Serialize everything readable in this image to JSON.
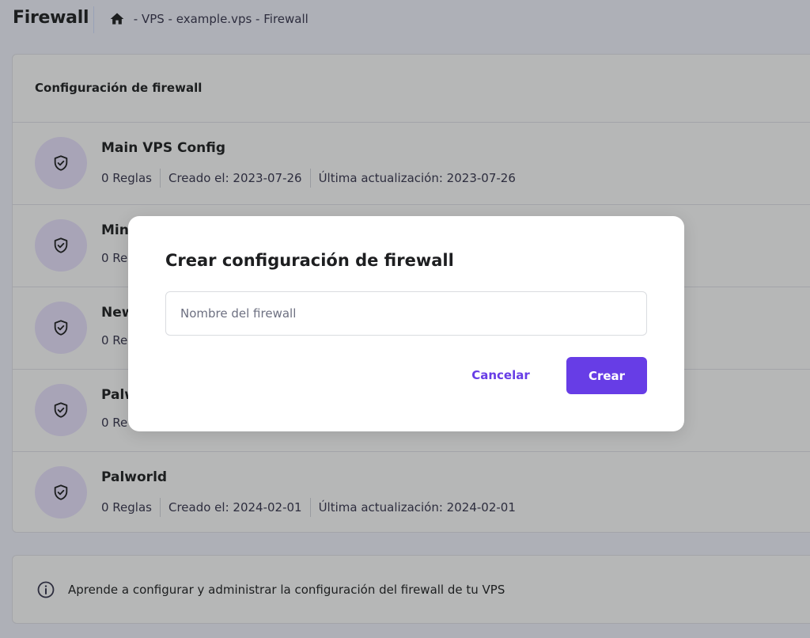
{
  "header": {
    "title": "Firewall",
    "breadcrumb": [
      "VPS",
      "example.vps",
      "Firewall"
    ],
    "breadcrumb_separator": " - "
  },
  "card": {
    "title": "Configuración de firewall",
    "rows": [
      {
        "name": "Main VPS Config",
        "rules": "0 Reglas",
        "created": "Creado el: 2023-07-26",
        "updated": "Última actualización: 2023-07-26"
      },
      {
        "name": "Min",
        "rules": "0 Re",
        "created": "",
        "updated": ""
      },
      {
        "name": "New",
        "rules": "0 Re",
        "created": "",
        "updated": ""
      },
      {
        "name": "Palw",
        "rules": "0 Re",
        "created": "",
        "updated": ""
      },
      {
        "name": "Palworld",
        "rules": "0 Reglas",
        "created": "Creado el: 2024-02-01",
        "updated": "Última actualización: 2024-02-01"
      }
    ]
  },
  "info": {
    "text": "Aprende a configurar y administrar la configuración del firewall de tu VPS"
  },
  "modal": {
    "title": "Crear configuración de firewall",
    "input_placeholder": "Nombre del firewall",
    "input_value": "",
    "cancel_label": "Cancelar",
    "create_label": "Crear"
  },
  "icons": {
    "home": "home-icon",
    "shield": "shield-check-icon",
    "info": "info-icon"
  },
  "colors": {
    "accent": "#673de6",
    "icon_bg": "#ebe4ff"
  }
}
